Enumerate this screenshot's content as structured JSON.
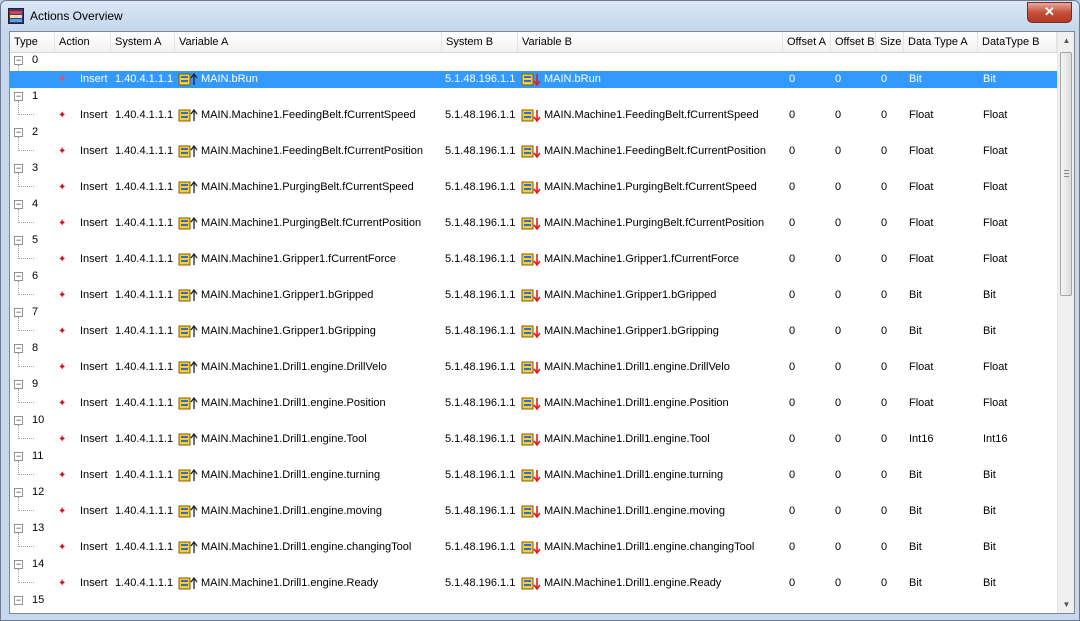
{
  "window": {
    "title": "Actions Overview",
    "close_glyph": "✕"
  },
  "columns": [
    "Type",
    "Action",
    "System A",
    "Variable A",
    "System B",
    "Variable B",
    "Offset A",
    "Offset B",
    "Size",
    "Data Type A",
    "DataType B"
  ],
  "rows": [
    {
      "group": "0",
      "action": "Insert",
      "system_a": "1.40.4.1.1.1",
      "variable_a": "MAIN.bRun",
      "system_b": "5.1.48.196.1.1",
      "variable_b": "MAIN.bRun",
      "offset_a": "0",
      "offset_b": "0",
      "size": "0",
      "data_type_a": "Bit",
      "data_type_b": "Bit",
      "selected": true
    },
    {
      "group": "1",
      "action": "Insert",
      "system_a": "1.40.4.1.1.1",
      "variable_a": "MAIN.Machine1.FeedingBelt.fCurrentSpeed",
      "system_b": "5.1.48.196.1.1",
      "variable_b": "MAIN.Machine1.FeedingBelt.fCurrentSpeed",
      "offset_a": "0",
      "offset_b": "0",
      "size": "0",
      "data_type_a": "Float",
      "data_type_b": "Float"
    },
    {
      "group": "2",
      "action": "Insert",
      "system_a": "1.40.4.1.1.1",
      "variable_a": "MAIN.Machine1.FeedingBelt.fCurrentPosition",
      "system_b": "5.1.48.196.1.1",
      "variable_b": "MAIN.Machine1.FeedingBelt.fCurrentPosition",
      "offset_a": "0",
      "offset_b": "0",
      "size": "0",
      "data_type_a": "Float",
      "data_type_b": "Float"
    },
    {
      "group": "3",
      "action": "Insert",
      "system_a": "1.40.4.1.1.1",
      "variable_a": "MAIN.Machine1.PurgingBelt.fCurrentSpeed",
      "system_b": "5.1.48.196.1.1",
      "variable_b": "MAIN.Machine1.PurgingBelt.fCurrentSpeed",
      "offset_a": "0",
      "offset_b": "0",
      "size": "0",
      "data_type_a": "Float",
      "data_type_b": "Float"
    },
    {
      "group": "4",
      "action": "Insert",
      "system_a": "1.40.4.1.1.1",
      "variable_a": "MAIN.Machine1.PurgingBelt.fCurrentPosition",
      "system_b": "5.1.48.196.1.1",
      "variable_b": "MAIN.Machine1.PurgingBelt.fCurrentPosition",
      "offset_a": "0",
      "offset_b": "0",
      "size": "0",
      "data_type_a": "Float",
      "data_type_b": "Float"
    },
    {
      "group": "5",
      "action": "Insert",
      "system_a": "1.40.4.1.1.1",
      "variable_a": "MAIN.Machine1.Gripper1.fCurrentForce",
      "system_b": "5.1.48.196.1.1",
      "variable_b": "MAIN.Machine1.Gripper1.fCurrentForce",
      "offset_a": "0",
      "offset_b": "0",
      "size": "0",
      "data_type_a": "Float",
      "data_type_b": "Float"
    },
    {
      "group": "6",
      "action": "Insert",
      "system_a": "1.40.4.1.1.1",
      "variable_a": "MAIN.Machine1.Gripper1.bGripped",
      "system_b": "5.1.48.196.1.1",
      "variable_b": "MAIN.Machine1.Gripper1.bGripped",
      "offset_a": "0",
      "offset_b": "0",
      "size": "0",
      "data_type_a": "Bit",
      "data_type_b": "Bit"
    },
    {
      "group": "7",
      "action": "Insert",
      "system_a": "1.40.4.1.1.1",
      "variable_a": "MAIN.Machine1.Gripper1.bGripping",
      "system_b": "5.1.48.196.1.1",
      "variable_b": "MAIN.Machine1.Gripper1.bGripping",
      "offset_a": "0",
      "offset_b": "0",
      "size": "0",
      "data_type_a": "Bit",
      "data_type_b": "Bit"
    },
    {
      "group": "8",
      "action": "Insert",
      "system_a": "1.40.4.1.1.1",
      "variable_a": "MAIN.Machine1.Drill1.engine.DrillVelo",
      "system_b": "5.1.48.196.1.1",
      "variable_b": "MAIN.Machine1.Drill1.engine.DrillVelo",
      "offset_a": "0",
      "offset_b": "0",
      "size": "0",
      "data_type_a": "Float",
      "data_type_b": "Float"
    },
    {
      "group": "9",
      "action": "Insert",
      "system_a": "1.40.4.1.1.1",
      "variable_a": "MAIN.Machine1.Drill1.engine.Position",
      "system_b": "5.1.48.196.1.1",
      "variable_b": "MAIN.Machine1.Drill1.engine.Position",
      "offset_a": "0",
      "offset_b": "0",
      "size": "0",
      "data_type_a": "Float",
      "data_type_b": "Float"
    },
    {
      "group": "10",
      "action": "Insert",
      "system_a": "1.40.4.1.1.1",
      "variable_a": "MAIN.Machine1.Drill1.engine.Tool",
      "system_b": "5.1.48.196.1.1",
      "variable_b": "MAIN.Machine1.Drill1.engine.Tool",
      "offset_a": "0",
      "offset_b": "0",
      "size": "0",
      "data_type_a": "Int16",
      "data_type_b": "Int16"
    },
    {
      "group": "11",
      "action": "Insert",
      "system_a": "1.40.4.1.1.1",
      "variable_a": "MAIN.Machine1.Drill1.engine.turning",
      "system_b": "5.1.48.196.1.1",
      "variable_b": "MAIN.Machine1.Drill1.engine.turning",
      "offset_a": "0",
      "offset_b": "0",
      "size": "0",
      "data_type_a": "Bit",
      "data_type_b": "Bit"
    },
    {
      "group": "12",
      "action": "Insert",
      "system_a": "1.40.4.1.1.1",
      "variable_a": "MAIN.Machine1.Drill1.engine.moving",
      "system_b": "5.1.48.196.1.1",
      "variable_b": "MAIN.Machine1.Drill1.engine.moving",
      "offset_a": "0",
      "offset_b": "0",
      "size": "0",
      "data_type_a": "Bit",
      "data_type_b": "Bit"
    },
    {
      "group": "13",
      "action": "Insert",
      "system_a": "1.40.4.1.1.1",
      "variable_a": "MAIN.Machine1.Drill1.engine.changingTool",
      "system_b": "5.1.48.196.1.1",
      "variable_b": "MAIN.Machine1.Drill1.engine.changingTool",
      "offset_a": "0",
      "offset_b": "0",
      "size": "0",
      "data_type_a": "Bit",
      "data_type_b": "Bit"
    },
    {
      "group": "14",
      "action": "Insert",
      "system_a": "1.40.4.1.1.1",
      "variable_a": "MAIN.Machine1.Drill1.engine.Ready",
      "system_b": "5.1.48.196.1.1",
      "variable_b": "MAIN.Machine1.Drill1.engine.Ready",
      "offset_a": "0",
      "offset_b": "0",
      "size": "0",
      "data_type_a": "Bit",
      "data_type_b": "Bit"
    },
    {
      "group": "15",
      "partial": true
    }
  ],
  "icons": {
    "window": "app-window-icon",
    "expander": "collapse-minus-icon",
    "action": "insert-star-icon",
    "variable_a": "variable-read-arrow-up-icon",
    "variable_b": "variable-write-arrow-down-icon"
  },
  "colors": {
    "selection": "#3399ff",
    "action_star": "#d01020",
    "arrow_down": "#e02020"
  }
}
